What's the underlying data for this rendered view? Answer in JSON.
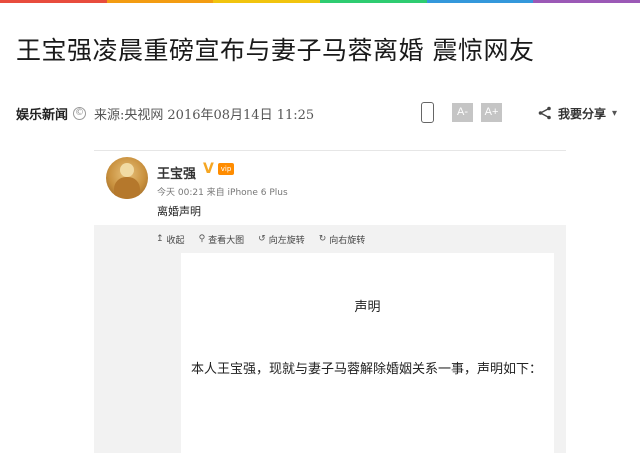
{
  "top_stripe": {
    "colors": [
      "#e84c3d",
      "#f39c12",
      "#f1c40f",
      "#2ecc71",
      "#3498db",
      "#9b59b6"
    ]
  },
  "article": {
    "headline": "王宝强凌晨重磅宣布与妻子马蓉离婚 震惊网友",
    "meta": {
      "source_name": "娱乐新闻",
      "copyright_icon": "©",
      "origin": "来源:央视网",
      "datetime": "2016年08月14日 11:25"
    },
    "tools": {
      "phone_icon": "phone-icon",
      "font_decrease_label": "A-",
      "font_increase_label": "A+",
      "share_label": "我要分享",
      "share_caret": "▾"
    }
  },
  "weibo_post": {
    "author": "王宝强",
    "verified_badge": "V",
    "vip_badge": "vip",
    "time_source": "今天 00:21 来自 iPhone 6 Plus",
    "text": "离婚声明",
    "toolbar": [
      {
        "icon": "↥",
        "label": "收起"
      },
      {
        "icon": "⚲",
        "label": "查看大图"
      },
      {
        "icon": "↺",
        "label": "向左旋转"
      },
      {
        "icon": "↻",
        "label": "向右旋转"
      }
    ],
    "image": {
      "title": "声明",
      "body": "本人王宝强，现就与妻子马蓉解除婚姻关系一事，声明如下："
    }
  }
}
